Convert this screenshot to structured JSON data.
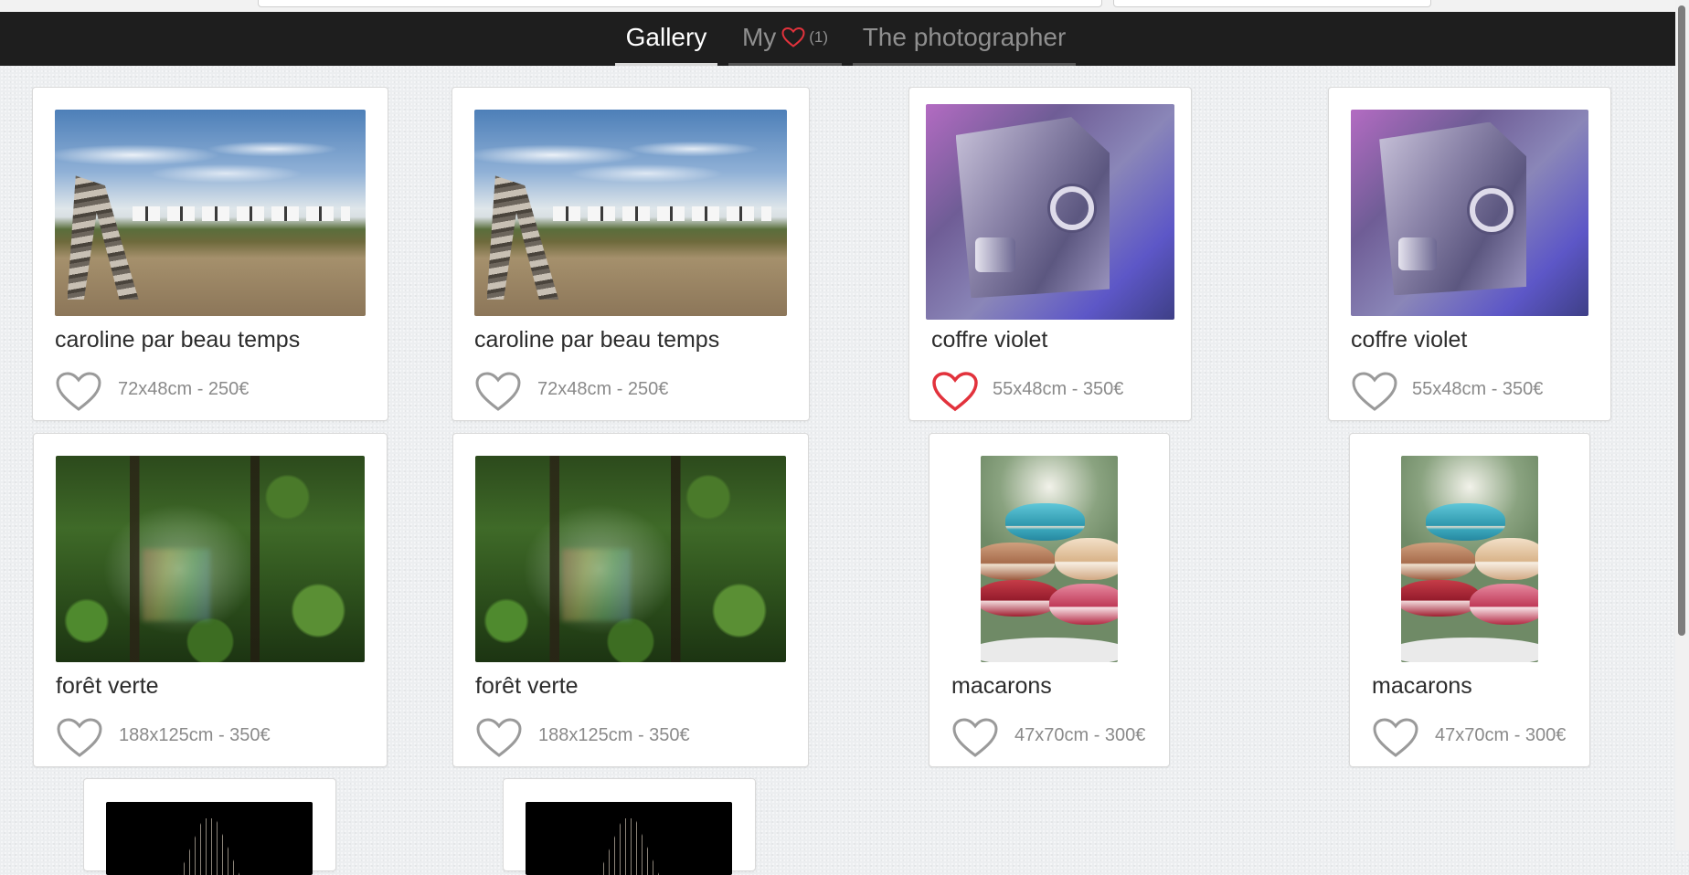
{
  "nav": {
    "tab_gallery": "Gallery",
    "tab_my": "My",
    "tab_my_count": "(1)",
    "tab_photographer": "The photographer"
  },
  "colors": {
    "navbar": "#1e1e1e",
    "liked_heart": "#e2323c",
    "unliked_heart": "#9a9a9a",
    "meta_text": "#8a8a8a"
  },
  "cards": [
    {
      "title": "caroline par beau temps",
      "meta": "72x48cm - 250€",
      "liked": false,
      "photo": "beach-lifeguard-chair"
    },
    {
      "title": "caroline par beau temps",
      "meta": "72x48cm - 250€",
      "liked": false,
      "photo": "beach-lifeguard-chair"
    },
    {
      "title": "coffre violet",
      "meta": "55x48cm - 350€",
      "liked": true,
      "photo": "purple-vault-door"
    },
    {
      "title": "coffre violet",
      "meta": "55x48cm - 350€",
      "liked": false,
      "photo": "purple-vault-door"
    },
    {
      "title": "forêt verte",
      "meta": "188x125cm - 350€",
      "liked": false,
      "photo": "green-forest"
    },
    {
      "title": "forêt verte",
      "meta": "188x125cm - 350€",
      "liked": false,
      "photo": "green-forest"
    },
    {
      "title": "macarons",
      "meta": "47x70cm - 300€",
      "liked": false,
      "photo": "macarons-stack"
    },
    {
      "title": "macarons",
      "meta": "47x70cm - 300€",
      "liked": false,
      "photo": "macarons-stack"
    },
    {
      "photo": "dark-light-rays"
    },
    {
      "photo": "dark-light-rays"
    }
  ],
  "icons": {
    "heart": "heart-icon",
    "heart_liked": "heart-filled-outline-icon"
  }
}
